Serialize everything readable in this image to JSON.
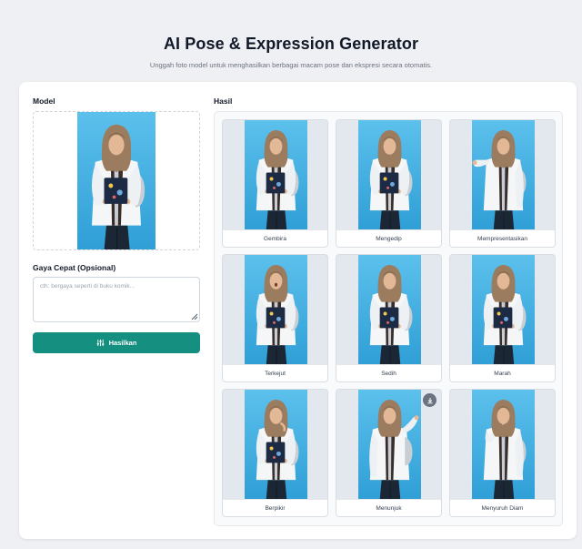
{
  "header": {
    "title": "AI Pose & Expression Generator",
    "subtitle": "Unggah foto model untuk menghasilkan berbagai macam pose dan ekspresi secara otomatis."
  },
  "left": {
    "model_label": "Model",
    "style_label": "Gaya Cepat (Opsional)",
    "style_placeholder": "cth: bergaya seperti di buku komik...",
    "style_value": "",
    "generate_label": "Hasilkan",
    "generate_icon": "sliders-icon"
  },
  "results": {
    "label": "Hasil",
    "items": [
      {
        "caption": "Gembira"
      },
      {
        "caption": "Mengedip"
      },
      {
        "caption": "Mempresentasikan"
      },
      {
        "caption": "Terkejut"
      },
      {
        "caption": "Sedih"
      },
      {
        "caption": "Marah"
      },
      {
        "caption": "Berpikir"
      },
      {
        "caption": "Menunjuk"
      },
      {
        "caption": "Menyuruh Diam"
      }
    ],
    "download_icon": "download-icon"
  },
  "colors": {
    "accent": "#158f7f",
    "photo_background": "#43b0e0",
    "hijab": "#9b7c5f",
    "jacket": "#f4f6f8",
    "pants": "#1c2736"
  }
}
